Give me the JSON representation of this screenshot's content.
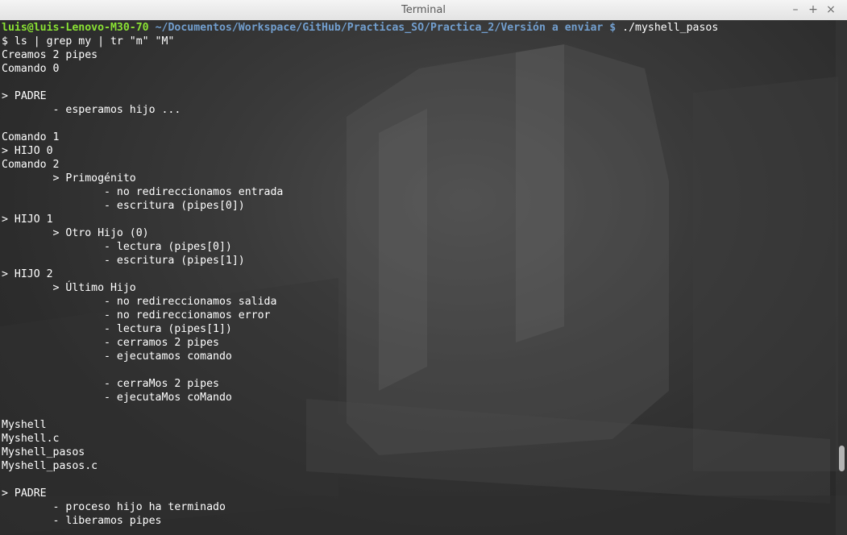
{
  "window": {
    "title": "Terminal",
    "minimize_label": "–",
    "maximize_label": "+",
    "close_label": "×"
  },
  "terminal": {
    "prompt": {
      "user_host": "luis@luis-Lenovo-M30-70",
      "path": "~/Documentos/Workspace/GitHub/Practicas_SO/Practica_2/Versión a enviar $",
      "command": " ./myshell_pasos"
    },
    "lines": [
      "$ ls | grep my | tr \"m\" \"M\"",
      "Creamos 2 pipes",
      "Comando 0",
      "",
      "> PADRE",
      "        - esperamos hijo ...",
      "",
      "Comando 1",
      "> HIJO 0",
      "Comando 2",
      "        > Primogénito",
      "                - no redireccionamos entrada",
      "                - escritura (pipes[0])",
      "> HIJO 1",
      "        > Otro Hijo (0)",
      "                - lectura (pipes[0])",
      "                - escritura (pipes[1])",
      "> HIJO 2",
      "        > Último Hijo",
      "                - no redireccionamos salida",
      "                - no redireccionamos error",
      "                - lectura (pipes[1])",
      "                - cerramos 2 pipes",
      "                - ejecutamos comando",
      "",
      "                - cerraMos 2 pipes",
      "                - ejecutaMos coMando",
      "",
      "Myshell",
      "Myshell.c",
      "Myshell_pasos",
      "Myshell_pasos.c",
      "",
      "> PADRE",
      "        - proceso hijo ha terminado",
      "        - liberamos pipes"
    ]
  },
  "scrollbar": {
    "position_fraction": 0.87,
    "visible_fraction": 0.05
  },
  "colors": {
    "prompt_user": "#8ae234",
    "prompt_path": "#729fcf",
    "text": "#ffffff"
  }
}
